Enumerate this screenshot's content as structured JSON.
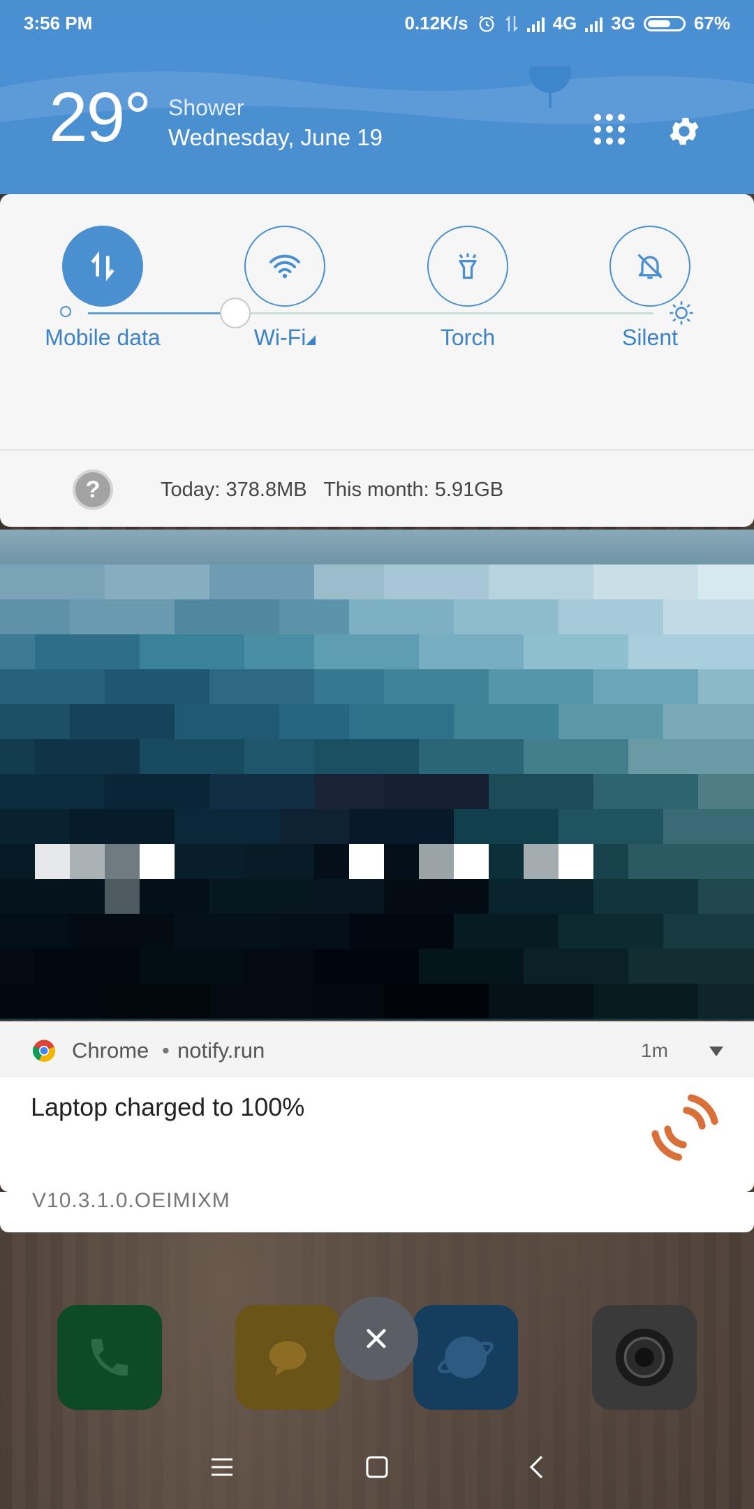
{
  "status_bar": {
    "time": "3:56 PM",
    "speed": "0.12K/s",
    "network1": "4G",
    "network2": "3G",
    "battery": "67%",
    "battery_level": 0.67
  },
  "weather": {
    "temperature": "29°",
    "condition": "Shower",
    "date": "Wednesday, June 19"
  },
  "quick_settings": {
    "tiles": [
      {
        "label": "Mobile data",
        "icon": "mobile-data-icon",
        "active": true
      },
      {
        "label": "Wi-Fi",
        "icon": "wifi-icon",
        "active": false
      },
      {
        "label": "Torch",
        "icon": "torch-icon",
        "active": false
      },
      {
        "label": "Silent",
        "icon": "silent-bell-icon",
        "active": false
      }
    ],
    "brightness_level": 0.26,
    "data_usage": "Today: 378.8MB   This month: 5.91GB"
  },
  "notification": {
    "app": "Chrome",
    "separator": "•",
    "source": "notify.run",
    "time": "1m",
    "title": "Laptop charged to 100%"
  },
  "behind_card_text": "V10.3.1.0.OEIMIXM",
  "colors": {
    "accent": "#4a8fd0",
    "notify_icon": "#d9703a"
  }
}
